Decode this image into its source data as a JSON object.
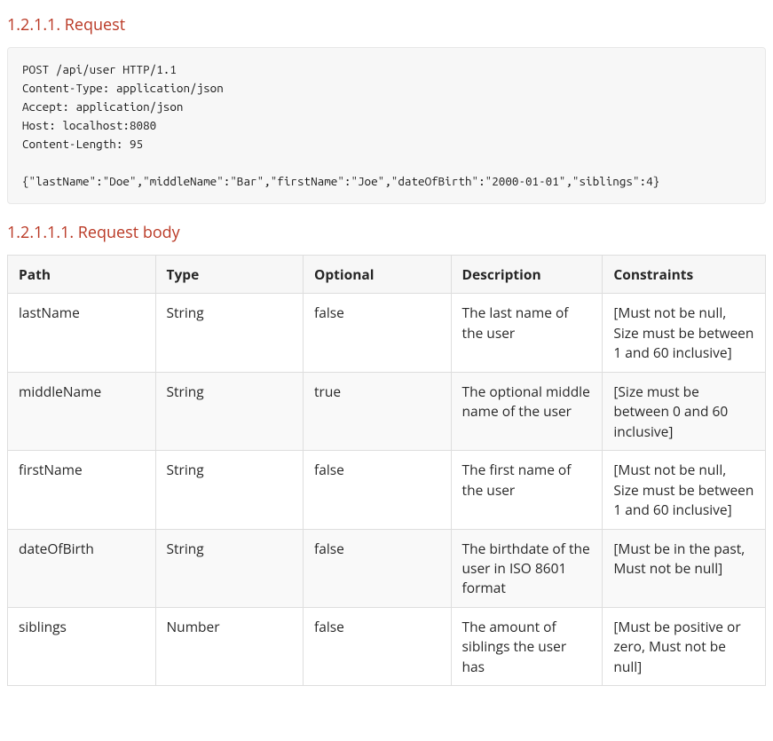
{
  "sections": {
    "request": {
      "title": "1.2.1.1. Request"
    },
    "requestBody": {
      "title": "1.2.1.1.1. Request body"
    }
  },
  "codeBlock": "POST /api/user HTTP/1.1\nContent-Type: application/json\nAccept: application/json\nHost: localhost:8080\nContent-Length: 95\n\n{\"lastName\":\"Doe\",\"middleName\":\"Bar\",\"firstName\":\"Joe\",\"dateOfBirth\":\"2000-01-01\",\"siblings\":4}",
  "table": {
    "headers": {
      "path": "Path",
      "type": "Type",
      "optional": "Optional",
      "description": "Description",
      "constraints": "Constraints"
    },
    "rows": [
      {
        "path": "lastName",
        "type": "String",
        "optional": "false",
        "description": "The last name of the user",
        "constraints": "[Must not be null, Size must be between 1 and 60 inclusive]"
      },
      {
        "path": "middleName",
        "type": "String",
        "optional": "true",
        "description": "The optional middle name of the user",
        "constraints": "[Size must be between 0 and 60 inclusive]"
      },
      {
        "path": "firstName",
        "type": "String",
        "optional": "false",
        "description": "The first name of the user",
        "constraints": "[Must not be null, Size must be between 1 and 60 inclusive]"
      },
      {
        "path": "dateOfBirth",
        "type": "String",
        "optional": "false",
        "description": "The birthdate of the user in ISO 8601 format",
        "constraints": "[Must be in the past, Must not be null]"
      },
      {
        "path": "siblings",
        "type": "Number",
        "optional": "false",
        "description": "The amount of siblings the user has",
        "constraints": "[Must be positive or zero, Must not be null]"
      }
    ]
  }
}
